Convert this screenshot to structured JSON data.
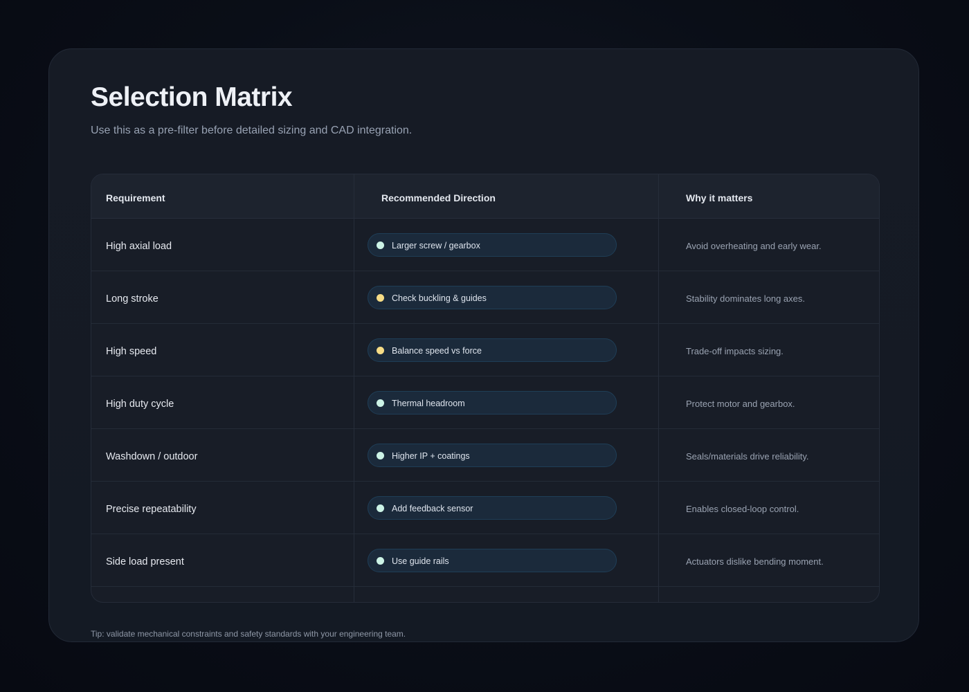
{
  "title": "Selection Matrix",
  "subtitle": "Use this as a pre-filter before detailed sizing and CAD integration.",
  "table": {
    "headers": {
      "requirement": "Requirement",
      "direction": "Recommended Direction",
      "why": "Why it matters"
    },
    "rows": [
      {
        "requirement": "High axial load",
        "direction": "Larger screw / gearbox",
        "status": "ok",
        "why": "Avoid overheating and early wear."
      },
      {
        "requirement": "Long stroke",
        "direction": "Check buckling & guides",
        "status": "caution",
        "why": "Stability dominates long axes."
      },
      {
        "requirement": "High speed",
        "direction": "Balance speed vs force",
        "status": "caution",
        "why": "Trade-off impacts sizing."
      },
      {
        "requirement": "High duty cycle",
        "direction": "Thermal headroom",
        "status": "ok",
        "why": "Protect motor and gearbox."
      },
      {
        "requirement": "Washdown / outdoor",
        "direction": "Higher IP + coatings",
        "status": "ok",
        "why": "Seals/materials drive reliability."
      },
      {
        "requirement": "Precise repeatability",
        "direction": "Add feedback sensor",
        "status": "ok",
        "why": "Enables closed-loop control."
      },
      {
        "requirement": "Side load present",
        "direction": "Use guide rails",
        "status": "ok",
        "why": "Actuators dislike bending moment."
      }
    ]
  },
  "status_colors": {
    "ok": "#ccf3e6",
    "caution": "#f6dc86"
  },
  "tip": "Tip: validate mechanical constraints and safety standards with your engineering team."
}
